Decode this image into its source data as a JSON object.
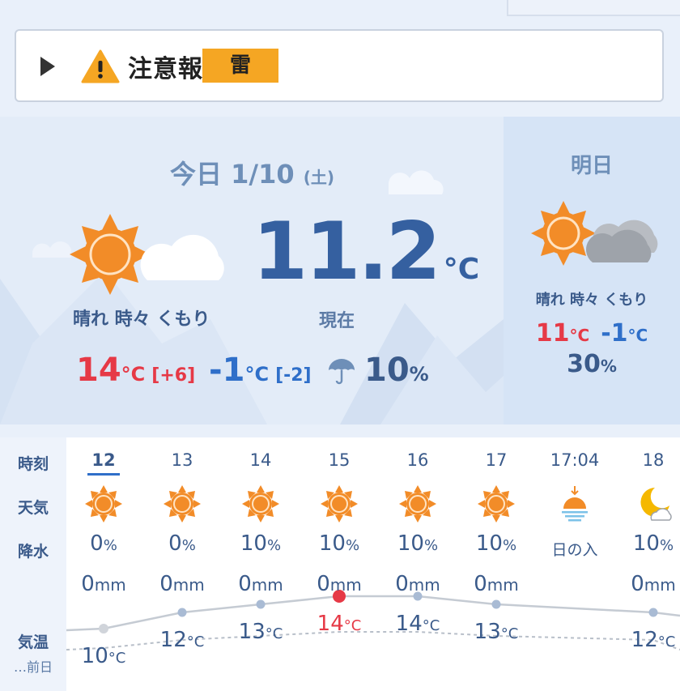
{
  "warning": {
    "label": "注意報",
    "type": "雷"
  },
  "today": {
    "date": "今日 1/10",
    "dow": "(土)",
    "current_temp": "11.2",
    "unit": "°C",
    "now_label": "現在",
    "condition": "晴れ 時々 くもり",
    "max": "14",
    "max_diff": "[+6]",
    "min": "-1",
    "min_diff": "[-2]",
    "pop": "10",
    "pop_unit": "%"
  },
  "tomorrow": {
    "label": "明日",
    "condition": "晴れ 時々 くもり",
    "max": "11",
    "min": "-1",
    "pop": "30",
    "unit": "°C",
    "pop_unit": "%"
  },
  "hourly": {
    "labels": {
      "time": "時刻",
      "weather": "天気",
      "precip": "降水",
      "temp": "気温",
      "prev": "…前日"
    },
    "hours": [
      {
        "time": "12",
        "icon": "sun-icon",
        "pop": "0",
        "mm": "0",
        "temp": "10",
        "current": true
      },
      {
        "time": "13",
        "icon": "sun-icon",
        "pop": "0",
        "mm": "0",
        "temp": "12"
      },
      {
        "time": "14",
        "icon": "sun-icon",
        "pop": "10",
        "mm": "0",
        "temp": "13"
      },
      {
        "time": "15",
        "icon": "sun-icon",
        "pop": "10",
        "mm": "0",
        "temp": "14",
        "max": true
      },
      {
        "time": "16",
        "icon": "sun-icon",
        "pop": "10",
        "mm": "0",
        "temp": "14"
      },
      {
        "time": "17",
        "icon": "sun-icon",
        "pop": "10",
        "mm": "0",
        "temp": "13"
      },
      {
        "time": "17:04",
        "icon": "sunset-icon",
        "event": "日の入"
      },
      {
        "time": "18",
        "icon": "moon-cloud-icon",
        "pop": "10",
        "mm": "0",
        "temp": "12"
      }
    ],
    "pop_unit": "%",
    "mm_unit": "mm",
    "temp_unit": "°C"
  },
  "colors": {
    "max": "#e63946",
    "min": "#2f6fc9",
    "accent": "#f5a623",
    "sun": "#f28c28"
  }
}
